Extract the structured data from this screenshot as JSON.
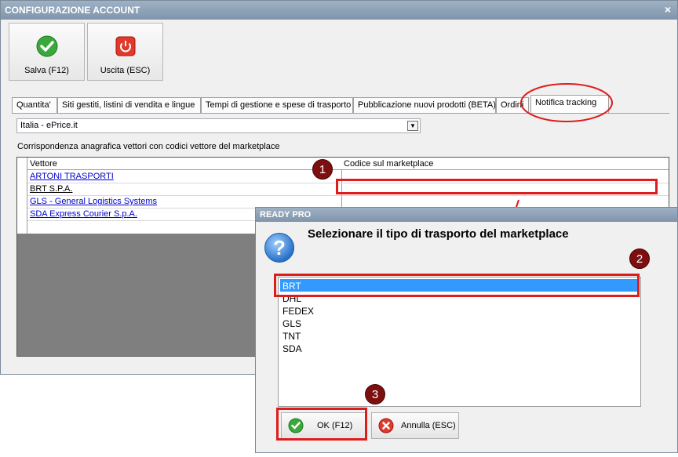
{
  "window": {
    "title": "CONFIGURAZIONE ACCOUNT",
    "close_label": "×"
  },
  "toolbar": {
    "save_label": "Salva (F12)",
    "exit_label": "Uscita (ESC)"
  },
  "tabs": [
    {
      "label": "Quantita'"
    },
    {
      "label": "Siti gestiti, listini di vendita e lingue"
    },
    {
      "label": "Tempi di gestione e spese di trasporto"
    },
    {
      "label": "Pubblicazione nuovi prodotti (BETA)"
    },
    {
      "label": "Ordini"
    },
    {
      "label": "Notifica tracking"
    }
  ],
  "site_select": {
    "value": "Italia - ePrice.it",
    "arrow": "▼"
  },
  "description": "Corrispondenza anagrafica vettori con codici vettore del marketplace",
  "grid": {
    "col_carrier": "Vettore",
    "col_code": "Codice sul marketplace",
    "rows": [
      {
        "carrier": "ARTONI TRASPORTI"
      },
      {
        "carrier": "BRT S.P.A."
      },
      {
        "carrier": "GLS - General Logistics Systems"
      },
      {
        "carrier": "SDA Express Courier S.p.A."
      }
    ]
  },
  "dialog": {
    "title": "READY PRO",
    "icon": "?",
    "prompt": "Selezionare il tipo di trasporto del marketplace",
    "options": [
      "BRT",
      "DHL",
      "FEDEX",
      "GLS",
      "TNT",
      "SDA"
    ],
    "ok_label": "OK (F12)",
    "cancel_label": "Annulla (ESC)"
  },
  "annotations": {
    "step1": "1",
    "step2": "2",
    "step3": "3"
  },
  "colors": {
    "highlight_red": "#dd1c1c",
    "selection_blue": "#3399ff",
    "title_bar": "#8fa3b8"
  }
}
